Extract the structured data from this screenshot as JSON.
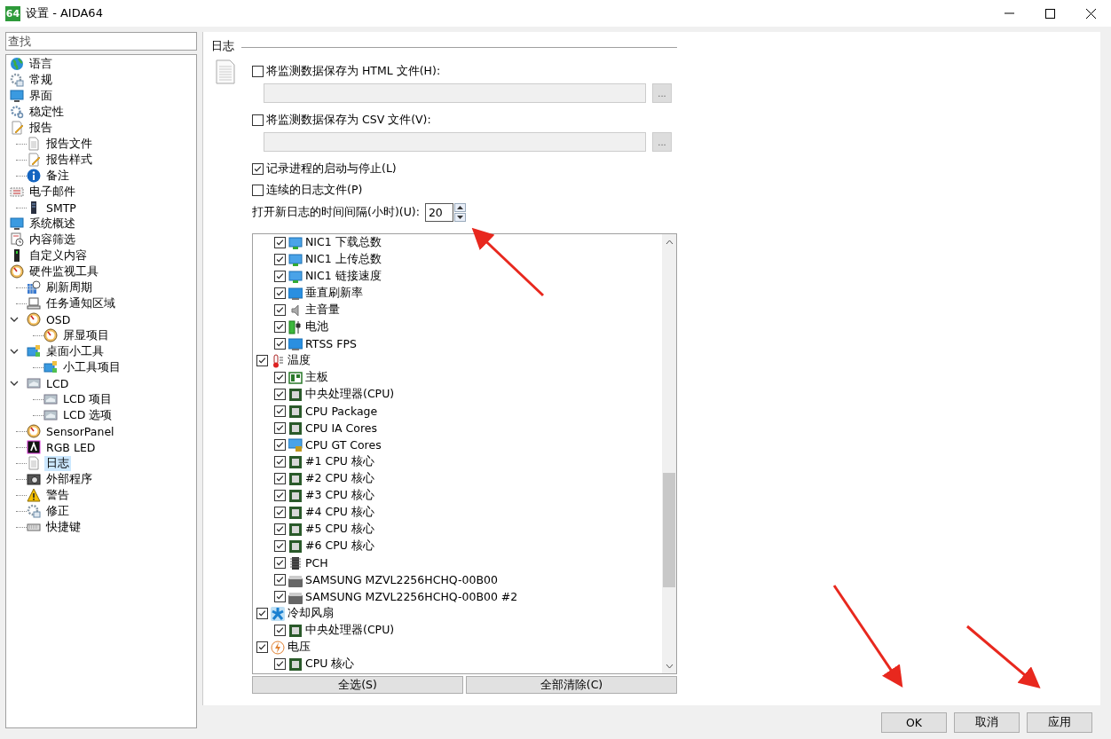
{
  "window": {
    "icon_label": "64",
    "title": "设置 - AIDA64"
  },
  "sidebar": {
    "search": {
      "placeholder": "查找"
    },
    "tree": [
      {
        "label": "语言",
        "kind": "globe",
        "selected": false
      },
      {
        "label": "常规",
        "kind": "gear-check",
        "selected": false
      },
      {
        "label": "界面",
        "kind": "monitor",
        "selected": false
      },
      {
        "label": "稳定性",
        "kind": "gears",
        "selected": false
      },
      {
        "label": "报告",
        "kind": "pencil-doc",
        "selected": false,
        "children": [
          {
            "label": "报告文件",
            "kind": "document",
            "selected": false
          },
          {
            "label": "报告样式",
            "kind": "pencil-doc",
            "selected": false
          },
          {
            "label": "备注",
            "kind": "info",
            "selected": false
          }
        ]
      },
      {
        "label": "电子邮件",
        "kind": "envelope",
        "selected": false,
        "children": [
          {
            "label": "SMTP",
            "kind": "server",
            "selected": false
          }
        ]
      },
      {
        "label": "系统概述",
        "kind": "monitor",
        "selected": false
      },
      {
        "label": "内容筛选",
        "kind": "filter",
        "selected": false
      },
      {
        "label": "自定义内容",
        "kind": "tower",
        "selected": false
      },
      {
        "label": "硬件监视工具",
        "kind": "gauge",
        "selected": false,
        "children": [
          {
            "label": "刷新周期",
            "kind": "clock",
            "selected": false
          },
          {
            "label": "任务通知区域",
            "kind": "laptop",
            "selected": false
          },
          {
            "label": "OSD",
            "kind": "gauge",
            "selected": false,
            "expanded": true,
            "children": [
              {
                "label": "屏显项目",
                "kind": "gauge",
                "selected": false
              }
            ]
          },
          {
            "label": "桌面小工具",
            "kind": "gadget",
            "selected": false,
            "expanded": true,
            "children": [
              {
                "label": "小工具项目",
                "kind": "gadget",
                "selected": false
              }
            ]
          },
          {
            "label": "LCD",
            "kind": "lcd",
            "selected": false,
            "expanded": true,
            "children": [
              {
                "label": "LCD 项目",
                "kind": "lcd",
                "selected": false
              },
              {
                "label": "LCD 选项",
                "kind": "lcd",
                "selected": false
              }
            ]
          },
          {
            "label": "SensorPanel",
            "kind": "gauge",
            "selected": false
          },
          {
            "label": "RGB LED",
            "kind": "rgb",
            "selected": false
          },
          {
            "label": "日志",
            "kind": "document",
            "selected": true
          },
          {
            "label": "外部程序",
            "kind": "camera",
            "selected": false
          },
          {
            "label": "警告",
            "kind": "warning",
            "selected": false
          },
          {
            "label": "修正",
            "kind": "gear-check",
            "selected": false
          },
          {
            "label": "快捷键",
            "kind": "keyboard",
            "selected": false
          }
        ]
      }
    ]
  },
  "section": {
    "title": "日志",
    "options": [
      {
        "kind": "checkbox",
        "label": "将监测数据保存为 HTML 文件(H):",
        "checked": false
      },
      {
        "kind": "path",
        "disabled": true,
        "browse": "..."
      },
      {
        "kind": "checkbox",
        "label": "将监测数据保存为 CSV 文件(V):",
        "checked": false
      },
      {
        "kind": "path",
        "disabled": true,
        "browse": "..."
      },
      {
        "kind": "checkbox",
        "label": "记录进程的启动与停止(L)",
        "checked": true
      },
      {
        "kind": "checkbox",
        "label": "连续的日志文件(P)",
        "checked": false
      },
      {
        "kind": "spin",
        "label": "打开新日志的时间间隔(小时)(U):",
        "value": "20"
      }
    ]
  },
  "sensor_list": {
    "items": [
      {
        "children": [
          {
            "label": "NIC1 下载总数",
            "kind": "net",
            "checked": true
          },
          {
            "label": "NIC1 上传总数",
            "kind": "net",
            "checked": true
          },
          {
            "label": "NIC1 链接速度",
            "kind": "net",
            "checked": true
          },
          {
            "label": "垂直刷新率",
            "kind": "screen",
            "checked": true
          },
          {
            "label": "主音量",
            "kind": "speaker",
            "checked": true
          },
          {
            "label": "电池",
            "kind": "battery",
            "checked": true
          },
          {
            "label": "RTSS FPS",
            "kind": "screen",
            "checked": true
          }
        ]
      },
      {
        "label": "温度",
        "kind": "thermometer",
        "checked": true,
        "children": [
          {
            "label": "主板",
            "kind": "board",
            "checked": true
          },
          {
            "label": "中央处理器(CPU)",
            "kind": "chip",
            "checked": true
          },
          {
            "label": "CPU Package",
            "kind": "chip",
            "checked": true
          },
          {
            "label": "CPU IA Cores",
            "kind": "chip",
            "checked": true
          },
          {
            "label": "CPU GT Cores",
            "kind": "chip-screen",
            "checked": true
          },
          {
            "label": "#1 CPU 核心",
            "kind": "chip",
            "checked": true
          },
          {
            "label": "#2 CPU 核心",
            "kind": "chip",
            "checked": true
          },
          {
            "label": "#3 CPU 核心",
            "kind": "chip",
            "checked": true
          },
          {
            "label": "#4 CPU 核心",
            "kind": "chip",
            "checked": true
          },
          {
            "label": "#5 CPU 核心",
            "kind": "chip",
            "checked": true
          },
          {
            "label": "#6 CPU 核心",
            "kind": "chip",
            "checked": true
          },
          {
            "label": "PCH",
            "kind": "ic",
            "checked": true
          },
          {
            "label": "SAMSUNG MZVL2256HCHQ-00B00",
            "kind": "drive",
            "checked": true
          },
          {
            "label": "SAMSUNG MZVL2256HCHQ-00B00 #2",
            "kind": "drive",
            "checked": true
          }
        ]
      },
      {
        "label": "冷却风扇",
        "kind": "fan",
        "checked": true,
        "children": [
          {
            "label": "中央处理器(CPU)",
            "kind": "chip",
            "checked": true
          }
        ]
      },
      {
        "label": "电压",
        "kind": "bolt",
        "checked": true,
        "children": [
          {
            "label": "CPU 核心",
            "kind": "chip",
            "checked": true
          }
        ]
      }
    ]
  },
  "list_buttons": [
    "全选(S)",
    "全部清除(C)"
  ],
  "dialog_buttons": [
    "OK",
    "取消",
    "应用"
  ]
}
